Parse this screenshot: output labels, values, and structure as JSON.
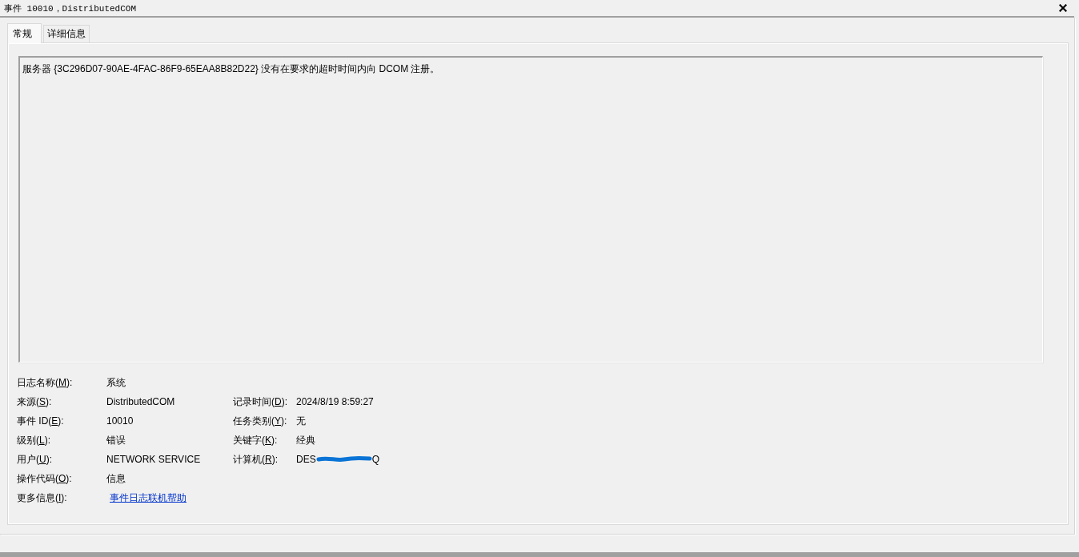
{
  "window": {
    "title": "事件 10010，DistributedCOM"
  },
  "tabs": [
    {
      "label": "常规",
      "selected": true
    },
    {
      "label": "详细信息",
      "selected": false
    }
  ],
  "description": "服务器 {3C296D07-90AE-4FAC-86F9-65EAA8B82D22} 没有在要求的超时时间内向 DCOM 注册。",
  "rows": [
    {
      "left": {
        "kind": "text",
        "label": "日志名称(",
        "key": "M",
        "label_end": "):",
        "value": "系统"
      }
    },
    {
      "left": {
        "kind": "text",
        "label": "来源(",
        "key": "S",
        "label_end": "):",
        "value": "DistributedCOM"
      },
      "right": {
        "kind": "text",
        "label": "记录时间(",
        "key": "D",
        "label_end": "):",
        "value": "2024/8/19 8:59:27"
      }
    },
    {
      "left": {
        "kind": "text",
        "label": "事件 ID(",
        "key": "E",
        "label_end": "):",
        "value": "10010"
      },
      "right": {
        "kind": "text",
        "label": "任务类别(",
        "key": "Y",
        "label_end": "):",
        "value": "无"
      }
    },
    {
      "left": {
        "kind": "text",
        "label": "级别(",
        "key": "L",
        "label_end": "):",
        "value": "错误"
      },
      "right": {
        "kind": "text",
        "label": "关键字(",
        "key": "K",
        "label_end": "):",
        "value": "经典"
      }
    },
    {
      "left": {
        "kind": "text",
        "label": "用户(",
        "key": "U",
        "label_end": "):",
        "value": "NETWORK SERVICE"
      },
      "right": {
        "kind": "redacted",
        "label": "计算机(",
        "key": "R",
        "label_end": "):",
        "value_parts": [
          "DES",
          "Q"
        ]
      }
    },
    {
      "left": {
        "kind": "text",
        "label": "操作代码(",
        "key": "O",
        "label_end": "):",
        "value": "信息"
      }
    },
    {
      "left": {
        "kind": "link",
        "label": "更多信息(",
        "key": "I",
        "label_end": "):",
        "value": "事件日志联机帮助"
      }
    }
  ]
}
